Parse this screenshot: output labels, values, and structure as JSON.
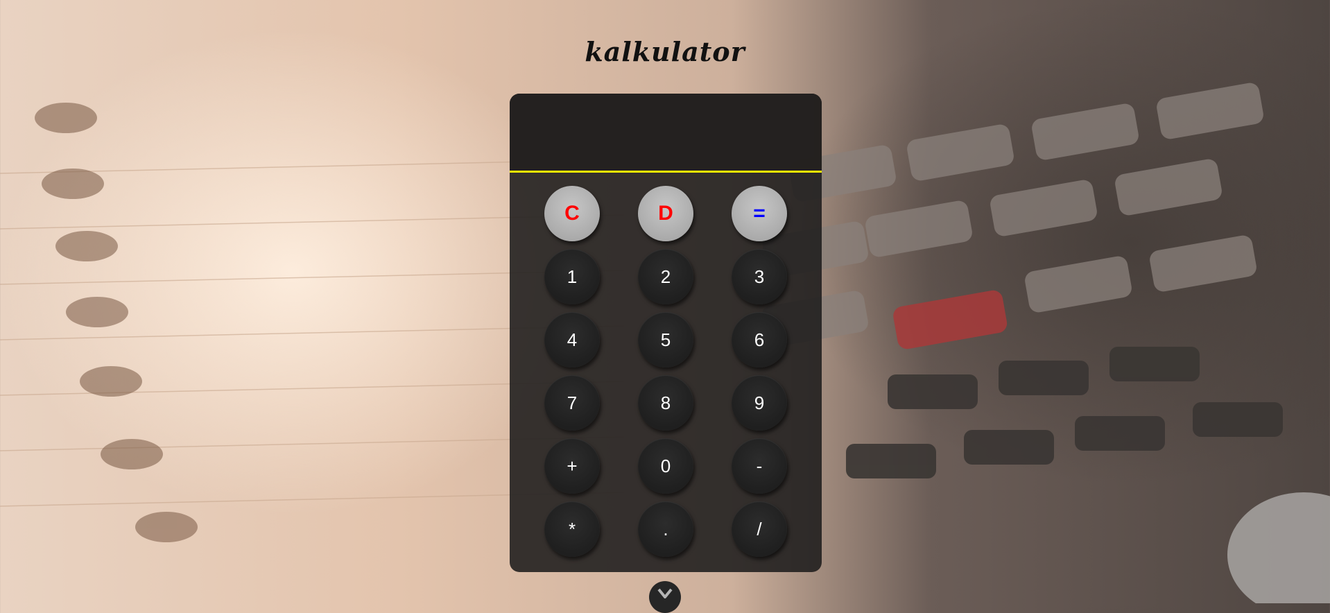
{
  "app": {
    "title": "kalkulator"
  },
  "display": {
    "value": ""
  },
  "colors": {
    "accent_line": "#f5f000",
    "clear_key": "#ff0000",
    "delete_key": "#ff0000",
    "equals_key": "#0000ff"
  },
  "keys": {
    "clear": "C",
    "delete": "D",
    "equals": "=",
    "one": "1",
    "two": "2",
    "three": "3",
    "four": "4",
    "five": "5",
    "six": "6",
    "seven": "7",
    "eight": "8",
    "nine": "9",
    "plus": "+",
    "zero": "0",
    "minus": "-",
    "multiply": "*",
    "decimal": ".",
    "divide": "/"
  },
  "scroll": {
    "icon": "chevron-down-icon"
  }
}
